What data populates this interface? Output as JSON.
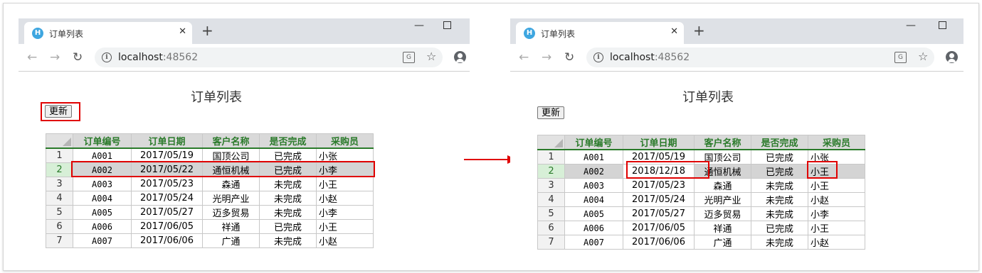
{
  "left": {
    "tab_title": "订单列表",
    "favicon": "H",
    "url_host": "localhost",
    "url_port": ":48562",
    "page_title": "订单列表",
    "update_button": "更新",
    "columns": [
      "订单编号",
      "订单日期",
      "客户名称",
      "是否完成",
      "采购员"
    ],
    "rows": [
      {
        "n": "1",
        "code": "A001",
        "date": "2017/05/19",
        "customer": "国顶公司",
        "status": "已完成",
        "buyer": "小张"
      },
      {
        "n": "2",
        "code": "A002",
        "date": "2017/05/22",
        "customer": "通恒机械",
        "status": "已完成",
        "buyer": "小李"
      },
      {
        "n": "3",
        "code": "A003",
        "date": "2017/05/23",
        "customer": "森通",
        "status": "未完成",
        "buyer": "小王"
      },
      {
        "n": "4",
        "code": "A004",
        "date": "2017/05/24",
        "customer": "光明产业",
        "status": "未完成",
        "buyer": "小赵"
      },
      {
        "n": "5",
        "code": "A005",
        "date": "2017/05/27",
        "customer": "迈多贸易",
        "status": "未完成",
        "buyer": "小李"
      },
      {
        "n": "6",
        "code": "A006",
        "date": "2017/06/05",
        "customer": "祥通",
        "status": "已完成",
        "buyer": "小王"
      },
      {
        "n": "7",
        "code": "A007",
        "date": "2017/06/06",
        "customer": "广通",
        "status": "未完成",
        "buyer": "小赵"
      }
    ]
  },
  "right": {
    "tab_title": "订单列表",
    "favicon": "H",
    "url_host": "localhost",
    "url_port": ":48562",
    "page_title": "订单列表",
    "update_button": "更新",
    "columns": [
      "订单编号",
      "订单日期",
      "客户名称",
      "是否完成",
      "采购员"
    ],
    "rows": [
      {
        "n": "1",
        "code": "A001",
        "date": "2017/05/19",
        "customer": "国顶公司",
        "status": "已完成",
        "buyer": "小张"
      },
      {
        "n": "2",
        "code": "A002",
        "date": "2018/12/18",
        "customer": "通恒机械",
        "status": "已完成",
        "buyer": "小王"
      },
      {
        "n": "3",
        "code": "A003",
        "date": "2017/05/23",
        "customer": "森通",
        "status": "未完成",
        "buyer": "小王"
      },
      {
        "n": "4",
        "code": "A004",
        "date": "2017/05/24",
        "customer": "光明产业",
        "status": "未完成",
        "buyer": "小赵"
      },
      {
        "n": "5",
        "code": "A005",
        "date": "2017/05/27",
        "customer": "迈多贸易",
        "status": "未完成",
        "buyer": "小李"
      },
      {
        "n": "6",
        "code": "A006",
        "date": "2017/06/05",
        "customer": "祥通",
        "status": "已完成",
        "buyer": "小王"
      },
      {
        "n": "7",
        "code": "A007",
        "date": "2017/06/06",
        "customer": "广通",
        "status": "未完成",
        "buyer": "小赵"
      }
    ]
  },
  "icons": {
    "close": "✕",
    "new_tab": "+",
    "back": "←",
    "forward": "→",
    "reload": "↻",
    "info": "i",
    "translate": "G",
    "star": "☆",
    "minimize": "—"
  },
  "colors": {
    "highlight": "#e00000",
    "header_text": "#2a7a2a",
    "favicon": "#3ea6e0"
  }
}
